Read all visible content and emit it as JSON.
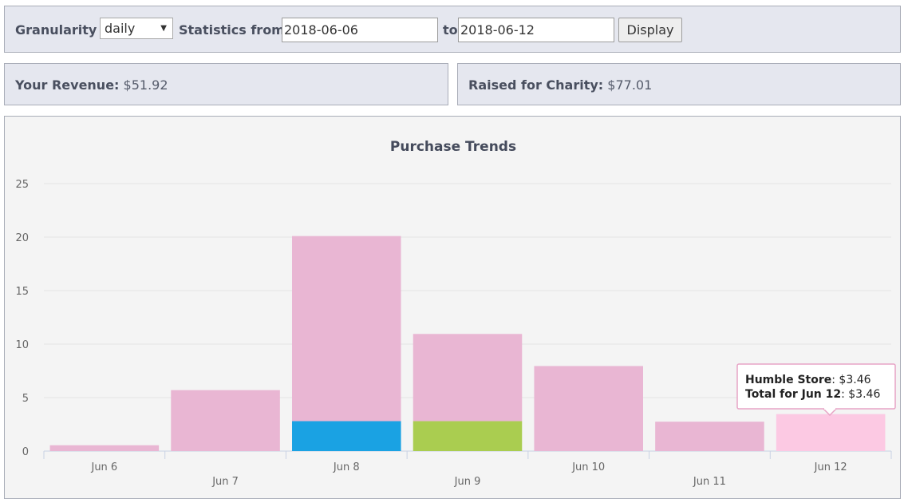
{
  "controls": {
    "granularity_label": "Granularity",
    "granularity_value": "daily",
    "stats_from_label": "Statistics from",
    "from_date": "2018-06-06",
    "to_label": "to",
    "to_date": "2018-06-12",
    "display_button": "Display"
  },
  "summary": {
    "revenue_label": "Your Revenue:",
    "revenue_value": "$51.92",
    "charity_label": "Raised for Charity:",
    "charity_value": "$77.01"
  },
  "tooltip": {
    "line1_label": "Humble Store",
    "line1_value": ": $3.46",
    "line2_label": "Total for Jun 12",
    "line2_value": ": $3.46"
  },
  "chart_data": {
    "type": "bar",
    "stacked": true,
    "title": "Purchase Trends",
    "categories": [
      "Jun 6",
      "Jun 7",
      "Jun 8",
      "Jun 9",
      "Jun 10",
      "Jun 11",
      "Jun 12"
    ],
    "ylim": [
      0,
      25
    ],
    "yticks": [
      0,
      5,
      10,
      15,
      20,
      25
    ],
    "grid": true,
    "series": [
      {
        "name": "",
        "color": "#1aa2e3",
        "values": [
          0,
          0,
          2.8,
          0,
          0,
          0,
          0
        ]
      },
      {
        "name": "",
        "color": "#aacd50",
        "values": [
          0,
          0,
          0,
          2.8,
          0,
          0,
          0
        ]
      },
      {
        "name": "Humble Store",
        "color": "#e9b6d3",
        "values": [
          0.55,
          5.7,
          17.3,
          8.15,
          7.95,
          2.75,
          3.46
        ]
      }
    ],
    "highlight": {
      "category": "Jun 12",
      "color": "#fcc9e3"
    }
  }
}
